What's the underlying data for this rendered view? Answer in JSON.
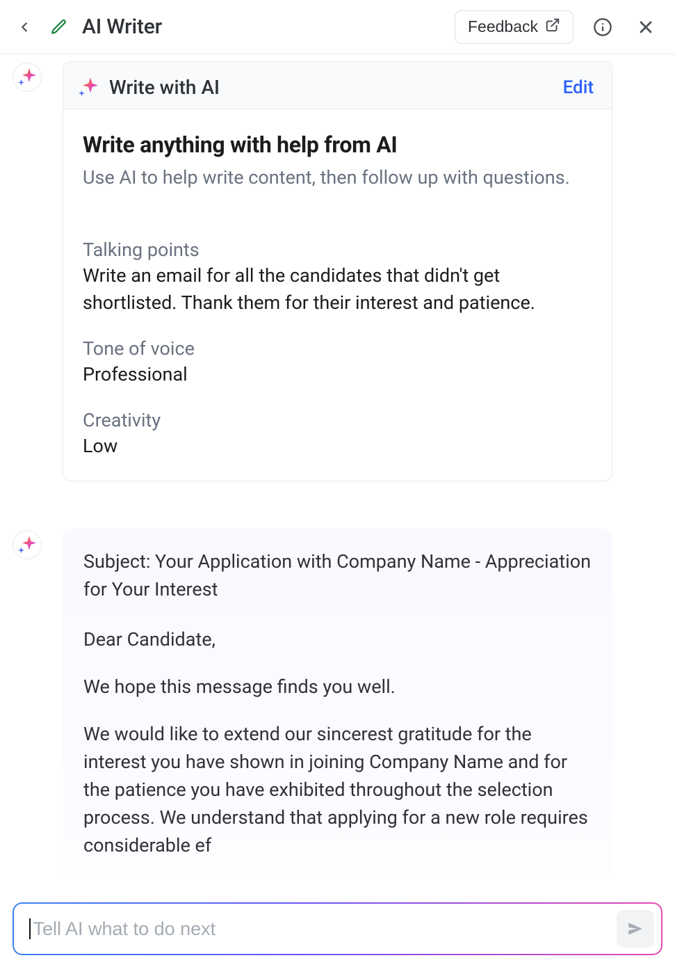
{
  "header": {
    "title": "AI Writer",
    "feedback_label": "Feedback"
  },
  "prompt_card": {
    "panel_label": "Write with AI",
    "edit_label": "Edit",
    "heading": "Write anything with help from AI",
    "subheading": "Use AI to help write content, then follow up with questions.",
    "fields": [
      {
        "label": "Talking points",
        "value": "Write an email for all the candidates that didn't get shortlisted. Thank them for their interest and patience."
      },
      {
        "label": "Tone of voice",
        "value": "Professional"
      },
      {
        "label": "Creativity",
        "value": "Low"
      }
    ]
  },
  "ai_output": {
    "subject_line": "Subject: Your Application with Company Name - Appreciation for Your Interest",
    "p1": "Dear Candidate,",
    "p2": "We hope this message finds you well.",
    "p3": "We would like to extend our sincerest gratitude for the interest you have shown in joining Company Name and for the patience you have exhibited throughout the selection process. We un­derstand that applying for a new role requires considerable ef­"
  },
  "composer": {
    "placeholder": "Tell AI what to do next"
  }
}
